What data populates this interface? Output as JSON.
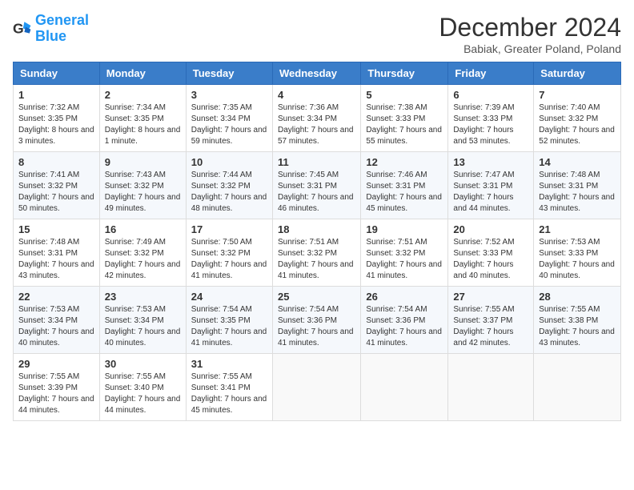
{
  "header": {
    "logo_line1": "General",
    "logo_line2": "Blue",
    "month_title": "December 2024",
    "location": "Babiak, Greater Poland, Poland"
  },
  "weekdays": [
    "Sunday",
    "Monday",
    "Tuesday",
    "Wednesday",
    "Thursday",
    "Friday",
    "Saturday"
  ],
  "weeks": [
    [
      {
        "day": "1",
        "sunrise": "Sunrise: 7:32 AM",
        "sunset": "Sunset: 3:35 PM",
        "daylight": "Daylight: 8 hours and 3 minutes."
      },
      {
        "day": "2",
        "sunrise": "Sunrise: 7:34 AM",
        "sunset": "Sunset: 3:35 PM",
        "daylight": "Daylight: 8 hours and 1 minute."
      },
      {
        "day": "3",
        "sunrise": "Sunrise: 7:35 AM",
        "sunset": "Sunset: 3:34 PM",
        "daylight": "Daylight: 7 hours and 59 minutes."
      },
      {
        "day": "4",
        "sunrise": "Sunrise: 7:36 AM",
        "sunset": "Sunset: 3:34 PM",
        "daylight": "Daylight: 7 hours and 57 minutes."
      },
      {
        "day": "5",
        "sunrise": "Sunrise: 7:38 AM",
        "sunset": "Sunset: 3:33 PM",
        "daylight": "Daylight: 7 hours and 55 minutes."
      },
      {
        "day": "6",
        "sunrise": "Sunrise: 7:39 AM",
        "sunset": "Sunset: 3:33 PM",
        "daylight": "Daylight: 7 hours and 53 minutes."
      },
      {
        "day": "7",
        "sunrise": "Sunrise: 7:40 AM",
        "sunset": "Sunset: 3:32 PM",
        "daylight": "Daylight: 7 hours and 52 minutes."
      }
    ],
    [
      {
        "day": "8",
        "sunrise": "Sunrise: 7:41 AM",
        "sunset": "Sunset: 3:32 PM",
        "daylight": "Daylight: 7 hours and 50 minutes."
      },
      {
        "day": "9",
        "sunrise": "Sunrise: 7:43 AM",
        "sunset": "Sunset: 3:32 PM",
        "daylight": "Daylight: 7 hours and 49 minutes."
      },
      {
        "day": "10",
        "sunrise": "Sunrise: 7:44 AM",
        "sunset": "Sunset: 3:32 PM",
        "daylight": "Daylight: 7 hours and 48 minutes."
      },
      {
        "day": "11",
        "sunrise": "Sunrise: 7:45 AM",
        "sunset": "Sunset: 3:31 PM",
        "daylight": "Daylight: 7 hours and 46 minutes."
      },
      {
        "day": "12",
        "sunrise": "Sunrise: 7:46 AM",
        "sunset": "Sunset: 3:31 PM",
        "daylight": "Daylight: 7 hours and 45 minutes."
      },
      {
        "day": "13",
        "sunrise": "Sunrise: 7:47 AM",
        "sunset": "Sunset: 3:31 PM",
        "daylight": "Daylight: 7 hours and 44 minutes."
      },
      {
        "day": "14",
        "sunrise": "Sunrise: 7:48 AM",
        "sunset": "Sunset: 3:31 PM",
        "daylight": "Daylight: 7 hours and 43 minutes."
      }
    ],
    [
      {
        "day": "15",
        "sunrise": "Sunrise: 7:48 AM",
        "sunset": "Sunset: 3:31 PM",
        "daylight": "Daylight: 7 hours and 43 minutes."
      },
      {
        "day": "16",
        "sunrise": "Sunrise: 7:49 AM",
        "sunset": "Sunset: 3:32 PM",
        "daylight": "Daylight: 7 hours and 42 minutes."
      },
      {
        "day": "17",
        "sunrise": "Sunrise: 7:50 AM",
        "sunset": "Sunset: 3:32 PM",
        "daylight": "Daylight: 7 hours and 41 minutes."
      },
      {
        "day": "18",
        "sunrise": "Sunrise: 7:51 AM",
        "sunset": "Sunset: 3:32 PM",
        "daylight": "Daylight: 7 hours and 41 minutes."
      },
      {
        "day": "19",
        "sunrise": "Sunrise: 7:51 AM",
        "sunset": "Sunset: 3:32 PM",
        "daylight": "Daylight: 7 hours and 41 minutes."
      },
      {
        "day": "20",
        "sunrise": "Sunrise: 7:52 AM",
        "sunset": "Sunset: 3:33 PM",
        "daylight": "Daylight: 7 hours and 40 minutes."
      },
      {
        "day": "21",
        "sunrise": "Sunrise: 7:53 AM",
        "sunset": "Sunset: 3:33 PM",
        "daylight": "Daylight: 7 hours and 40 minutes."
      }
    ],
    [
      {
        "day": "22",
        "sunrise": "Sunrise: 7:53 AM",
        "sunset": "Sunset: 3:34 PM",
        "daylight": "Daylight: 7 hours and 40 minutes."
      },
      {
        "day": "23",
        "sunrise": "Sunrise: 7:53 AM",
        "sunset": "Sunset: 3:34 PM",
        "daylight": "Daylight: 7 hours and 40 minutes."
      },
      {
        "day": "24",
        "sunrise": "Sunrise: 7:54 AM",
        "sunset": "Sunset: 3:35 PM",
        "daylight": "Daylight: 7 hours and 41 minutes."
      },
      {
        "day": "25",
        "sunrise": "Sunrise: 7:54 AM",
        "sunset": "Sunset: 3:36 PM",
        "daylight": "Daylight: 7 hours and 41 minutes."
      },
      {
        "day": "26",
        "sunrise": "Sunrise: 7:54 AM",
        "sunset": "Sunset: 3:36 PM",
        "daylight": "Daylight: 7 hours and 41 minutes."
      },
      {
        "day": "27",
        "sunrise": "Sunrise: 7:55 AM",
        "sunset": "Sunset: 3:37 PM",
        "daylight": "Daylight: 7 hours and 42 minutes."
      },
      {
        "day": "28",
        "sunrise": "Sunrise: 7:55 AM",
        "sunset": "Sunset: 3:38 PM",
        "daylight": "Daylight: 7 hours and 43 minutes."
      }
    ],
    [
      {
        "day": "29",
        "sunrise": "Sunrise: 7:55 AM",
        "sunset": "Sunset: 3:39 PM",
        "daylight": "Daylight: 7 hours and 44 minutes."
      },
      {
        "day": "30",
        "sunrise": "Sunrise: 7:55 AM",
        "sunset": "Sunset: 3:40 PM",
        "daylight": "Daylight: 7 hours and 44 minutes."
      },
      {
        "day": "31",
        "sunrise": "Sunrise: 7:55 AM",
        "sunset": "Sunset: 3:41 PM",
        "daylight": "Daylight: 7 hours and 45 minutes."
      },
      null,
      null,
      null,
      null
    ]
  ]
}
